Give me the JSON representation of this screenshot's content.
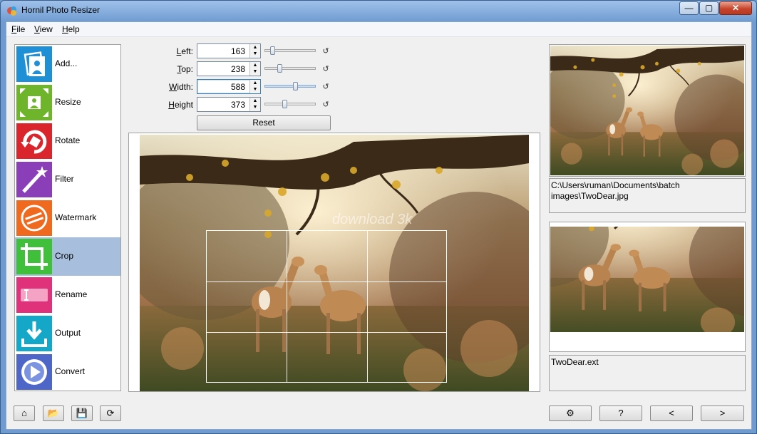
{
  "window": {
    "title": "Hornil Photo Resizer",
    "controls": {
      "minimize": "—",
      "maximize": "▢",
      "close": "✕"
    }
  },
  "menu": [
    "File",
    "View",
    "Help"
  ],
  "sidebar": {
    "items": [
      {
        "label": "Add...",
        "icon": "add-photo-icon",
        "color": "#1f8fd6"
      },
      {
        "label": "Resize",
        "icon": "resize-icon",
        "color": "#6fb52c"
      },
      {
        "label": "Rotate",
        "icon": "rotate-icon",
        "color": "#d9252b"
      },
      {
        "label": "Filter",
        "icon": "filter-wand-icon",
        "color": "#8a3fb8"
      },
      {
        "label": "Watermark",
        "icon": "watermark-icon",
        "color": "#ef6a1e"
      },
      {
        "label": "Crop",
        "icon": "crop-icon",
        "color": "#3fbf3a",
        "active": true
      },
      {
        "label": "Rename",
        "icon": "rename-icon",
        "color": "#e0327a"
      },
      {
        "label": "Output",
        "icon": "output-download-icon",
        "color": "#15a7c7"
      },
      {
        "label": "Convert",
        "icon": "convert-play-icon",
        "color": "#4d66c8"
      }
    ]
  },
  "crop_controls": {
    "left": {
      "label": "Left:",
      "value": "163",
      "level": 0.12
    },
    "top": {
      "label": "Top:",
      "value": "238",
      "level": 0.28
    },
    "width": {
      "label": "Width:",
      "value": "588",
      "level": 0.62
    },
    "height": {
      "label": "Height",
      "value": "373",
      "level": 0.38
    },
    "reset_label": "Reset"
  },
  "preview": {
    "watermark_text": "download 3k"
  },
  "thumbnails": {
    "source_path": "C:\\Users\\ruman\\Documents\\batch images\\TwoDear.jpg",
    "output_name": "TwoDear.ext"
  },
  "bottom_toolbar": {
    "home": "⌂",
    "open": "📂",
    "save": "💾",
    "refresh": "⟳",
    "settings": "⚙",
    "help": "?",
    "prev": "<",
    "next": ">"
  },
  "colors": {
    "active_item_bg": "#a7bfdc",
    "title_bar": "#9fc1ea"
  }
}
